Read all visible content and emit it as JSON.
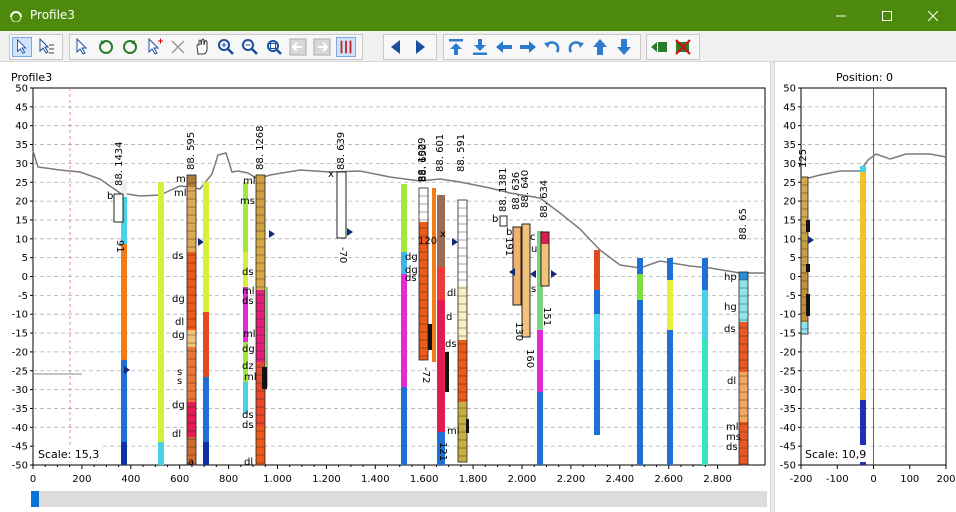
{
  "window": {
    "title": "Profile3"
  },
  "toolbar": {
    "groups": [
      [
        "arrow-pointer-icon",
        "arrow-multi-select-icon"
      ],
      [
        "select-drag-icon",
        "rotate-cw-icon",
        "rotate-ccw-icon",
        "pointer-plus-icon",
        "close-x-icon",
        "hand-pan-icon",
        "zoom-in-icon",
        "zoom-out-icon",
        "zoom-extents-icon",
        "back-arrow-icon",
        "forward-arrow-icon",
        "columns-icon"
      ],
      [
        "triangle-left-icon",
        "triangle-right-icon"
      ],
      [
        "move-top-icon",
        "move-bottom-icon",
        "move-left-icon",
        "move-right-icon",
        "undo-arc-icon",
        "redo-arc-icon",
        "move-up-icon",
        "move-down-icon"
      ],
      [
        "import-icon",
        "delete-icon"
      ]
    ]
  },
  "left_panel": {
    "title": "Profile3",
    "scale_label": "Scale: 15,3",
    "y_ticks": [
      "50",
      "45",
      "40",
      "35",
      "30",
      "25",
      "20",
      "15",
      "10",
      "5",
      "0",
      "-5",
      "-10",
      "-15",
      "-20",
      "-25",
      "-30",
      "-35",
      "-40",
      "-45",
      "-50"
    ],
    "x_ticks": [
      "0",
      "200",
      "400",
      "600",
      "800",
      "1.000",
      "1.200",
      "1.400",
      "1.600",
      "1.800",
      "2.000",
      "2.200",
      "2.400",
      "2.600",
      "2.800"
    ],
    "boreholes": [
      {
        "id": "88. 1434",
        "bottom": "91",
        "notes": [
          "b"
        ]
      },
      {
        "id": "88. 595",
        "notes": [
          "m",
          "ml",
          "ds",
          "dg",
          "dl",
          "dg",
          "s",
          "s",
          "dg",
          "dl",
          "a"
        ]
      },
      {
        "id": "88. 1268",
        "notes": [
          "ml",
          "ms",
          "ds",
          "ml",
          "ds",
          "ml",
          "dg",
          "dz",
          "ml",
          "ds",
          "ds",
          "dl"
        ]
      },
      {
        "id": "88. 639",
        "bottom": "-70",
        "notes": [
          "x"
        ]
      },
      {
        "id": "88. 1029",
        "bottom": "-72",
        "notes": [
          "dg",
          "dg",
          "ds",
          "120"
        ]
      },
      {
        "id": "88. 650",
        "notes": [
          "x",
          "dl",
          "ds",
          "ml",
          "d"
        ]
      },
      {
        "id": "88. 601"
      },
      {
        "id": "88. 591",
        "bottom": "121"
      },
      {
        "id": "88. 1381",
        "bottom": "191",
        "notes": [
          "b",
          "b"
        ]
      },
      {
        "id": "88. 636",
        "bottom": "130"
      },
      {
        "id": "88. 640",
        "bottom": "160",
        "notes": [
          "s"
        ]
      },
      {
        "id": "88. 634",
        "bottom": "151",
        "notes": [
          "c",
          "u"
        ]
      },
      {
        "id": "88. 65",
        "notes": [
          "hp",
          "hg",
          "ds",
          "dl",
          "ml",
          "ms",
          "ds"
        ]
      }
    ]
  },
  "right_panel": {
    "title": "Position: 0",
    "scale_label": "Scale: 10,9",
    "y_ticks": [
      "50",
      "45",
      "40",
      "35",
      "30",
      "25",
      "20",
      "15",
      "10",
      "5",
      "0",
      "-5",
      "-10",
      "-15",
      "-20",
      "-25",
      "-30",
      "-35",
      "-40",
      "-45",
      "-50"
    ],
    "x_ticks": [
      "-200",
      "-100",
      "0",
      "100",
      "200"
    ],
    "borehole_id": "125"
  },
  "colors": {
    "titlebar": "#4d8a0c",
    "accent": "#0a74d6",
    "terrain": "#7a7a7a"
  }
}
